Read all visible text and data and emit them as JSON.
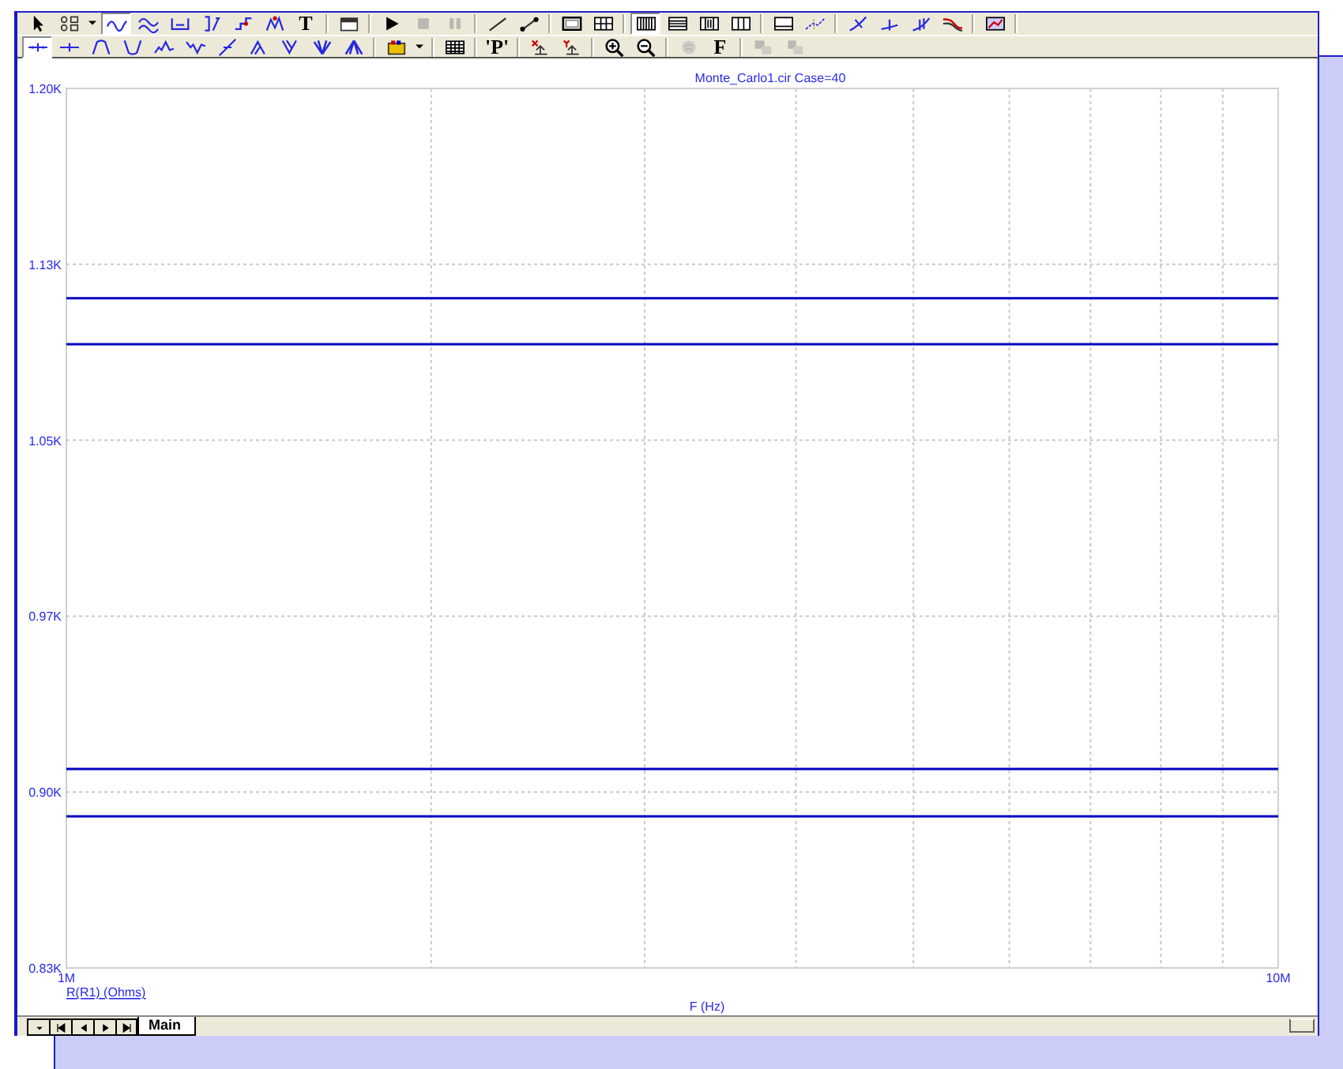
{
  "toolbars": [
    {
      "items": [
        {
          "kind": "tool",
          "pressed": false,
          "disabled": false
        },
        {
          "kind": "tool",
          "pressed": false,
          "disabled": false
        },
        {
          "kind": "dropdown",
          "pressed": false,
          "disabled": false
        },
        {
          "kind": "tool",
          "pressed": true,
          "disabled": false
        },
        {
          "kind": "tool",
          "pressed": false,
          "disabled": false
        },
        {
          "kind": "tool",
          "pressed": false,
          "disabled": false
        },
        {
          "kind": "tool",
          "pressed": false,
          "disabled": false
        },
        {
          "kind": "tool",
          "pressed": false,
          "disabled": false
        },
        {
          "kind": "tool",
          "pressed": false,
          "disabled": false
        },
        {
          "kind": "text",
          "label": "T",
          "pressed": false,
          "disabled": false
        },
        {
          "kind": "separator"
        },
        {
          "kind": "tool",
          "pressed": false,
          "disabled": false
        },
        {
          "kind": "separator"
        },
        {
          "kind": "tool",
          "pressed": false,
          "disabled": false
        },
        {
          "kind": "tool",
          "pressed": false,
          "disabled": true
        },
        {
          "kind": "tool",
          "pressed": false,
          "disabled": true
        },
        {
          "kind": "separator"
        },
        {
          "kind": "tool",
          "pressed": false,
          "disabled": false
        },
        {
          "kind": "tool",
          "pressed": false,
          "disabled": false
        },
        {
          "kind": "separator"
        },
        {
          "kind": "tool",
          "pressed": false,
          "disabled": false
        },
        {
          "kind": "tool",
          "pressed": false,
          "disabled": false
        },
        {
          "kind": "separator"
        },
        {
          "kind": "tool",
          "pressed": true,
          "disabled": false
        },
        {
          "kind": "tool",
          "pressed": false,
          "disabled": false
        },
        {
          "kind": "tool",
          "pressed": false,
          "disabled": false
        },
        {
          "kind": "tool",
          "pressed": false,
          "disabled": false
        },
        {
          "kind": "separator"
        },
        {
          "kind": "tool",
          "pressed": false,
          "disabled": false
        },
        {
          "kind": "tool",
          "pressed": false,
          "disabled": false
        },
        {
          "kind": "separator"
        },
        {
          "kind": "tool",
          "pressed": false,
          "disabled": false
        },
        {
          "kind": "tool",
          "pressed": false,
          "disabled": false
        },
        {
          "kind": "tool",
          "pressed": false,
          "disabled": false
        },
        {
          "kind": "tool",
          "pressed": false,
          "disabled": false
        },
        {
          "kind": "separator"
        },
        {
          "kind": "tool",
          "pressed": false,
          "disabled": false
        },
        {
          "kind": "separator"
        }
      ]
    },
    {
      "items": [
        {
          "kind": "tool",
          "pressed": true,
          "disabled": false
        },
        {
          "kind": "tool",
          "pressed": false,
          "disabled": false
        },
        {
          "kind": "tool",
          "pressed": false,
          "disabled": false
        },
        {
          "kind": "tool",
          "pressed": false,
          "disabled": false
        },
        {
          "kind": "tool",
          "pressed": false,
          "disabled": false
        },
        {
          "kind": "tool",
          "pressed": false,
          "disabled": false
        },
        {
          "kind": "tool",
          "pressed": false,
          "disabled": false
        },
        {
          "kind": "tool",
          "pressed": false,
          "disabled": false
        },
        {
          "kind": "tool",
          "pressed": false,
          "disabled": false
        },
        {
          "kind": "tool",
          "pressed": false,
          "disabled": false
        },
        {
          "kind": "tool",
          "pressed": false,
          "disabled": false
        },
        {
          "kind": "separator"
        },
        {
          "kind": "tool",
          "pressed": false,
          "disabled": false
        },
        {
          "kind": "dropdown",
          "pressed": false,
          "disabled": false
        },
        {
          "kind": "separator"
        },
        {
          "kind": "tool",
          "pressed": false,
          "disabled": false
        },
        {
          "kind": "separator"
        },
        {
          "kind": "text",
          "label": "'P'",
          "pressed": false,
          "disabled": false
        },
        {
          "kind": "separator"
        },
        {
          "kind": "tool",
          "pressed": false,
          "disabled": false
        },
        {
          "kind": "tool",
          "pressed": false,
          "disabled": false
        },
        {
          "kind": "separator"
        },
        {
          "kind": "tool",
          "pressed": false,
          "disabled": false
        },
        {
          "kind": "tool",
          "pressed": false,
          "disabled": false
        },
        {
          "kind": "separator"
        },
        {
          "kind": "tool",
          "pressed": false,
          "disabled": true
        },
        {
          "kind": "text",
          "label": "F",
          "pressed": false,
          "disabled": false
        },
        {
          "kind": "separator"
        },
        {
          "kind": "tool",
          "pressed": false,
          "disabled": true
        },
        {
          "kind": "tool",
          "pressed": false,
          "disabled": true
        }
      ]
    }
  ],
  "plot": {
    "chart_data": {
      "type": "line",
      "title": "Monte_Carlo1.cir Case=40",
      "xlabel": "F (Hz)",
      "grid": true,
      "x": [
        1000000,
        10000000
      ],
      "xlim": [
        1000000,
        10000000
      ],
      "ylim": [
        0.825,
        1.2
      ],
      "xticks": [
        {
          "value": 1000000,
          "label": "1M"
        },
        {
          "value": 10000000,
          "label": "10M"
        }
      ],
      "yticks": [
        {
          "value": 1.2,
          "label": "1.20K"
        },
        {
          "value": 1.125,
          "label": "1.13K"
        },
        {
          "value": 1.05,
          "label": "1.05K"
        },
        {
          "value": 0.975,
          "label": "0.97K"
        },
        {
          "value": 0.9,
          "label": "0.90K"
        },
        {
          "value": 0.825,
          "label": "0.83K"
        }
      ],
      "series": [
        {
          "name": "R(R1) (Ohms)",
          "color": "#0000c0",
          "values": [
            1.1105,
            1.1105
          ]
        },
        {
          "color": "#0000c0",
          "values": [
            1.0909,
            1.0909
          ]
        },
        {
          "color": "#0000c0",
          "values": [
            0.9098,
            0.9098
          ]
        },
        {
          "color": "#0000c0",
          "values": [
            0.8896,
            0.8896
          ]
        }
      ]
    }
  },
  "sheet_tabs": [
    {
      "label": "Main",
      "selected": true
    }
  ]
}
